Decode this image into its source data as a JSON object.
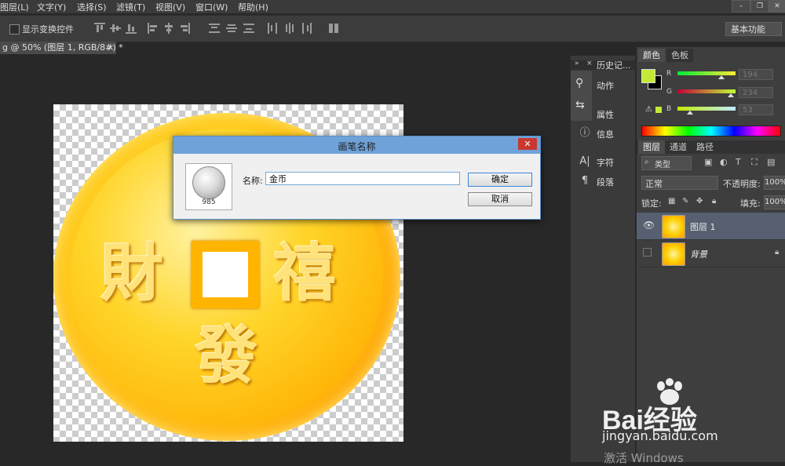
{
  "menubar": {
    "items": [
      "图层(L)",
      "文字(Y)",
      "选择(S)",
      "滤镜(T)",
      "视图(V)",
      "窗口(W)",
      "帮助(H)"
    ],
    "window_controls": [
      "–",
      "❐",
      "✕"
    ]
  },
  "options_bar": {
    "show_transform_controls": "显示变换控件",
    "workspace": "基本功能"
  },
  "document_tab": {
    "title": "g @ 50% (图层 1, RGB/8#) *",
    "close": "×"
  },
  "coin": {
    "char_left": "財",
    "char_right": "禧",
    "char_bottom": "發"
  },
  "panel_icons": [
    {
      "label": "历史记..."
    },
    {
      "label": "动作"
    },
    {
      "label": "属性"
    },
    {
      "label": "信息"
    },
    {
      "label": "字符"
    },
    {
      "label": "段落"
    }
  ],
  "color_panel": {
    "tabs": [
      "颜色",
      "色板"
    ],
    "channels": [
      {
        "name": "R",
        "value": "194",
        "fraction": 0.76
      },
      {
        "name": "G",
        "value": "234",
        "fraction": 0.92
      },
      {
        "name": "B",
        "value": "53",
        "fraction": 0.21
      }
    ],
    "foreground": "#c2ea35",
    "background": "#000000"
  },
  "layers_panel": {
    "tabs": [
      "图层",
      "通道",
      "路径"
    ],
    "filter_kind": "类型",
    "blend_mode": "正常",
    "opacity_label": "不透明度:",
    "opacity_value": "100%",
    "lock_label": "锁定:",
    "fill_label": "填充:",
    "fill_value": "100%",
    "layers": [
      {
        "name": "图层 1",
        "visible": true,
        "selected": true
      },
      {
        "name": "背景",
        "visible": false,
        "selected": false,
        "locked": true
      }
    ]
  },
  "dialog": {
    "title": "画笔名称",
    "close": "✕",
    "brush_size": "985",
    "name_label": "名称:",
    "name_value": "金币",
    "ok": "确定",
    "cancel": "取消"
  },
  "watermark": {
    "brand": "Bai经验",
    "url": "jingyan.baidu.com",
    "windows_activation": "激活 Windows"
  }
}
